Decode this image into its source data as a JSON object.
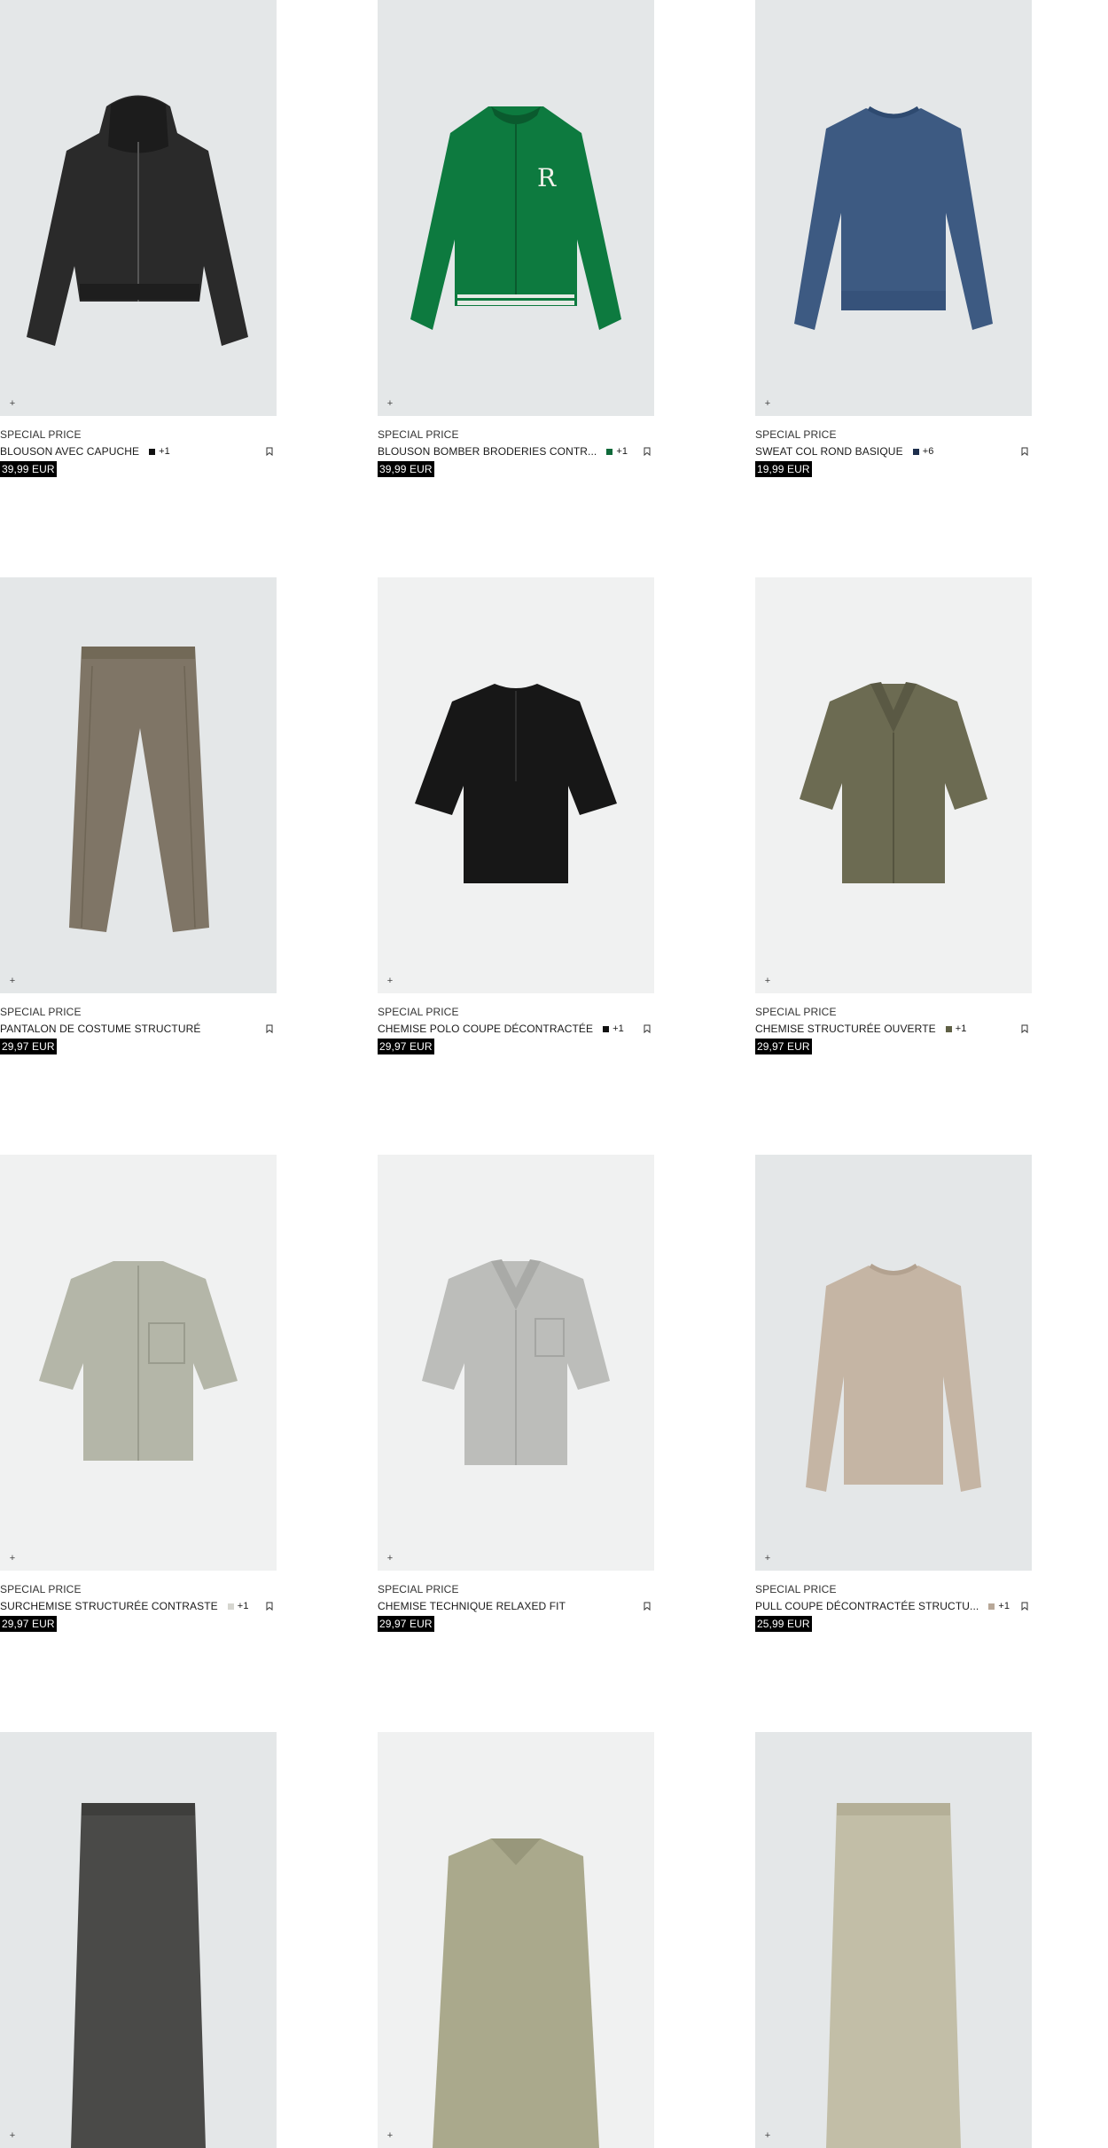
{
  "products": [
    {
      "tag": "SPECIAL PRICE",
      "name": "BLOUSON AVEC CAPUCHE",
      "swatch": "#111111",
      "more": "+1",
      "price": "39,99 EUR",
      "bg": "#e4e7e8",
      "garment": "leather-hooded-jacket-image"
    },
    {
      "tag": "SPECIAL PRICE",
      "name": "BLOUSON BOMBER BRODERIES CONTR...",
      "swatch": "#0f6a3a",
      "more": "+1",
      "price": "39,99 EUR",
      "bg": "#e4e7e8",
      "garment": "green-bomber-jacket-image"
    },
    {
      "tag": "SPECIAL PRICE",
      "name": "SWEAT COL ROND BASIQUE",
      "swatch": "#1e2f4d",
      "more": "+6",
      "price": "19,99 EUR",
      "bg": "#e4e7e8",
      "garment": "blue-sweatshirt-image"
    },
    {
      "tag": "SPECIAL PRICE",
      "name": "PANTALON DE COSTUME STRUCTURÉ",
      "swatch": "",
      "more": "",
      "price": "29,97 EUR",
      "bg": "#e4e7e8",
      "garment": "taupe-trousers-image"
    },
    {
      "tag": "SPECIAL PRICE",
      "name": "CHEMISE POLO COUPE DÉCONTRACTÉE",
      "swatch": "#111111",
      "more": "+1",
      "price": "29,97 EUR",
      "bg": "#f0f1f1",
      "garment": "black-polo-shirt-image"
    },
    {
      "tag": "SPECIAL PRICE",
      "name": "CHEMISE STRUCTURÉE OUVERTE",
      "swatch": "#5f6045",
      "more": "+1",
      "price": "29,97 EUR",
      "bg": "#f0f1f1",
      "garment": "olive-open-shirt-image"
    },
    {
      "tag": "SPECIAL PRICE",
      "name": "SURCHEMISE STRUCTURÉE CONTRASTE",
      "swatch": "#d6d6d0",
      "more": "+1",
      "price": "29,97 EUR",
      "bg": "#f0f1f1",
      "garment": "textured-overshirt-image"
    },
    {
      "tag": "SPECIAL PRICE",
      "name": "CHEMISE TECHNIQUE RELAXED FIT",
      "swatch": "",
      "more": "",
      "price": "29,97 EUR",
      "bg": "#f0f1f1",
      "garment": "grey-technical-shirt-image"
    },
    {
      "tag": "SPECIAL PRICE",
      "name": "PULL COUPE DÉCONTRACTÉE STRUCTU...",
      "swatch": "#b8a898",
      "more": "+1",
      "price": "25,99 EUR",
      "bg": "#e4e7e8",
      "garment": "beige-sweater-image"
    },
    {
      "tag": "",
      "name": "",
      "swatch": "",
      "more": "",
      "price": "",
      "bg": "#e4e7e8",
      "garment": "grey-check-trousers-image"
    },
    {
      "tag": "",
      "name": "",
      "swatch": "",
      "more": "",
      "price": "",
      "bg": "#f0f1f1",
      "garment": "sage-shirt-image"
    },
    {
      "tag": "",
      "name": "",
      "swatch": "",
      "more": "",
      "price": "",
      "bg": "#e4e7e8",
      "garment": "khaki-trousers-image"
    }
  ],
  "ui": {
    "add_symbol": "+"
  }
}
